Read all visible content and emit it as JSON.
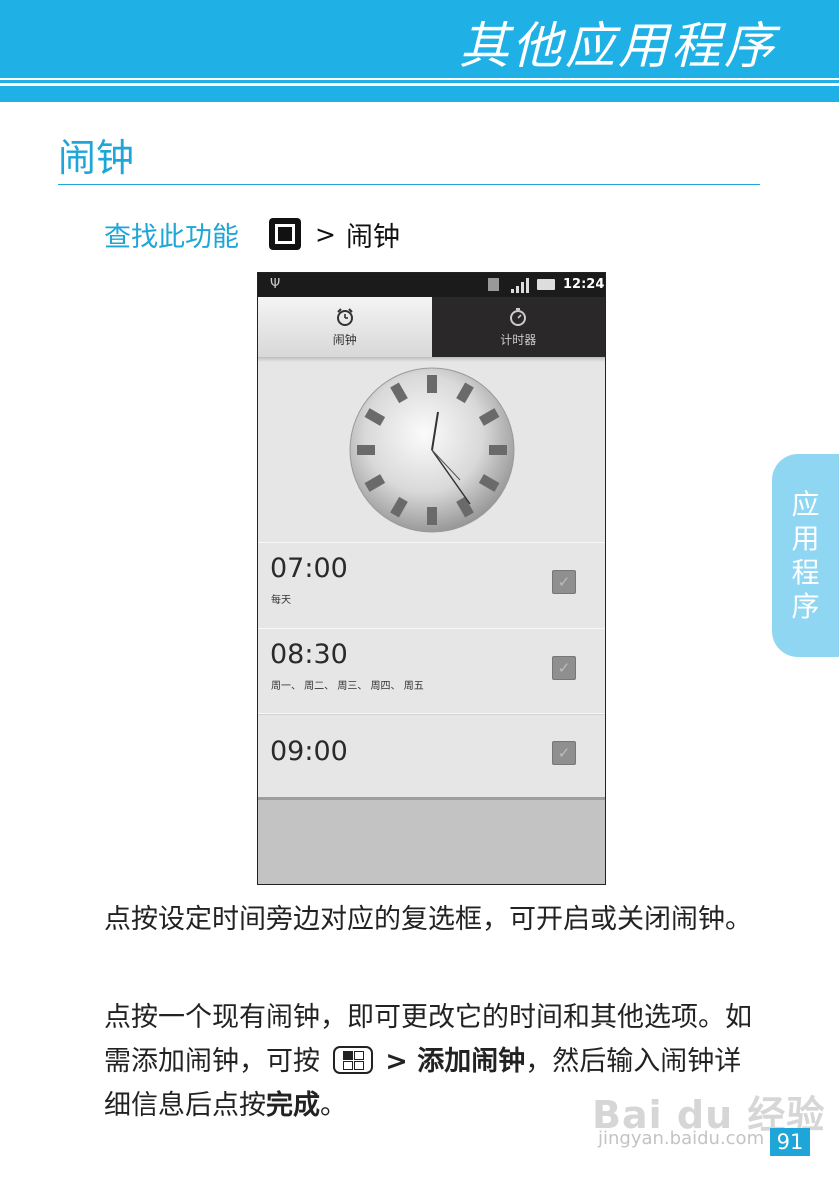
{
  "header": {
    "title": "其他应用程序"
  },
  "section": {
    "title": "闹钟"
  },
  "find": {
    "label": "查找此功能",
    "arrow": ">",
    "target": "闹钟"
  },
  "phone": {
    "status": {
      "time": "12:24"
    },
    "tabs": [
      {
        "label": "闹钟",
        "icon": "alarm-clock-icon"
      },
      {
        "label": "计时器",
        "icon": "stopwatch-icon"
      }
    ],
    "alarms": [
      {
        "time": "07:00",
        "days": "每天",
        "checked": true
      },
      {
        "time": "08:30",
        "days": "周一、 周二、 周三、 周四、 周五",
        "checked": true
      },
      {
        "time": "09:00",
        "days": "",
        "checked": true
      }
    ]
  },
  "side_tab": {
    "chars": [
      "应",
      "用",
      "程",
      "序"
    ]
  },
  "body": {
    "p1": "点按设定时间旁边对应的复选框，可开启或关闭闹钟。",
    "p2_a": "点按一个现有闹钟，即可更改它的时间和其他选项。如需添加闹钟，可按",
    "p2_b": "> 添加闹钟",
    "p2_c": "，然后输入闹钟详细信息后点按",
    "p2_d": "完成",
    "p2_e": "。"
  },
  "watermark": {
    "text": "Bai du 经验",
    "url": "jingyan.baidu.com"
  },
  "page_number": "91",
  "colors": {
    "accent": "#1fb0e6",
    "side_tab": "#8fd6f3"
  }
}
